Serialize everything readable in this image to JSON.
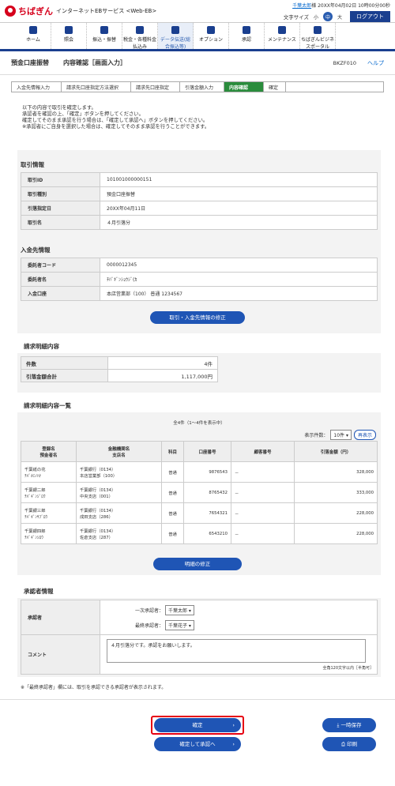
{
  "header": {
    "logo_text": "ちばぎん",
    "service": "インターネットEBサービス <Web-EB>",
    "user_name": "千葉太郎",
    "user_suffix": "様",
    "datetime": "20XX年04月02日 10時00分00秒",
    "font_size_label": "文字サイズ",
    "font_small": "小",
    "font_mid": "中",
    "font_large": "大",
    "logout": "ログアウト"
  },
  "nav": [
    {
      "label": "ホーム",
      "icon": "home-icon"
    },
    {
      "label": "照会",
      "icon": "inquiry-icon"
    },
    {
      "label": "振込・振替",
      "icon": "transfer-icon"
    },
    {
      "label": "税金・各種料金払込み",
      "icon": "tax-icon"
    },
    {
      "label": "データ伝送(総合振込等)",
      "icon": "data-icon"
    },
    {
      "label": "オプション",
      "icon": "gear-icon"
    },
    {
      "label": "承認",
      "icon": "approve-icon"
    },
    {
      "label": "メンテナンス",
      "icon": "tool-icon"
    },
    {
      "label": "ちばぎんビジネスポータル",
      "icon": "portal-icon"
    }
  ],
  "page": {
    "title": "預金口座振替",
    "subtitle": "内容確認［画面入力］",
    "screen_id": "BKZF010",
    "help": "ヘルプ"
  },
  "steps": [
    "入金先情報入力",
    "請求先口座指定方法選択",
    "請求先口座指定",
    "引落金額入力",
    "内容確認",
    "確定"
  ],
  "intro": [
    "以下の内容で取引を確定します。",
    "承認者を確認の上、「確定」ボタンを押してください。",
    "確定してそのまま承認を行う場合は、「確定して承認へ」ボタンを押してください。",
    "※承認者にご自身を選択した場合は、確定してそのまま承認を行うことができます。"
  ],
  "trade": {
    "title": "取引情報",
    "rows": [
      {
        "k": "取引ID",
        "v": "101001000000151"
      },
      {
        "k": "取引種別",
        "v": "預金口座振替"
      },
      {
        "k": "引落指定日",
        "v": "20XX年04月11日"
      },
      {
        "k": "取引名",
        "v": "４月引落分"
      }
    ]
  },
  "payee": {
    "title": "入金先情報",
    "rows": [
      {
        "k": "委託者コード",
        "v": "0000012345"
      },
      {
        "k": "委託者名",
        "v": "ﾁﾊﾞｷﾞﾝｼｮｳｼﾞ(ｶ"
      },
      {
        "k": "入金口座",
        "v": "本店営業部（100） 普通 1234567"
      }
    ],
    "modify_btn": "取引・入金先情報の修正"
  },
  "summary": {
    "title": "請求明細内容",
    "rows": [
      {
        "k": "件数",
        "v": "4件"
      },
      {
        "k": "引落金額合計",
        "v": "1,117,000円"
      }
    ]
  },
  "list": {
    "title": "請求明細内容一覧",
    "count_text": "全4件（1～4件を表示中）",
    "show_count_label": "表示件数：",
    "show_count": "10件",
    "redisplay": "再表示",
    "headers": [
      "登録名\n預金者名",
      "金融機関名\n支店名",
      "科目",
      "口座番号",
      "顧客番号",
      "引落金額（円）"
    ],
    "rows": [
      {
        "name": "千葉紙の花\nﾁﾊﾞｶﾐﾉﾊﾅ",
        "bank": "千葉銀行（0134）\n本店営業部（100）",
        "kind": "普通",
        "acct": "9876543",
        "cust": "－",
        "amount": "328,000"
      },
      {
        "name": "千葉銀二郎\nﾁﾊﾞｷﾞﾝｼﾞﾛｳ",
        "bank": "千葉銀行（0134）\n中央支店（001）",
        "kind": "普通",
        "acct": "8765432",
        "cust": "－",
        "amount": "333,000"
      },
      {
        "name": "千葉銀三郎\nﾁﾊﾞｷﾞﾝｻﾌﾞﾛｳ",
        "bank": "千葉銀行（0134）\n成田支店（286）",
        "kind": "普通",
        "acct": "7654321",
        "cust": "－",
        "amount": "228,000"
      },
      {
        "name": "千葉銀四郎\nﾁﾊﾞｷﾞﾝｼﾛｳ",
        "bank": "千葉銀行（0134）\n佐倉支店（287）",
        "kind": "普通",
        "acct": "6543210",
        "cust": "－",
        "amount": "228,000"
      }
    ],
    "modify_btn": "明細の修正"
  },
  "approver": {
    "title": "承認者情報",
    "label": "承認者",
    "first_label": "一次承認者：",
    "first_value": "千葉太郎",
    "final_label": "最終承認者：",
    "final_value": "千葉花子",
    "comment_label": "コメント",
    "comment_value": "４月引落分です。承認をお願いします。",
    "comment_hint": "全角120文字以内［半角可］",
    "note": "※「最終承認者」欄には、取引を承認できる承認者が表示されます。"
  },
  "actions": {
    "confirm": "確定",
    "confirm_approve": "確定して承認へ",
    "temp_save": "一時保存",
    "print": "印刷"
  }
}
